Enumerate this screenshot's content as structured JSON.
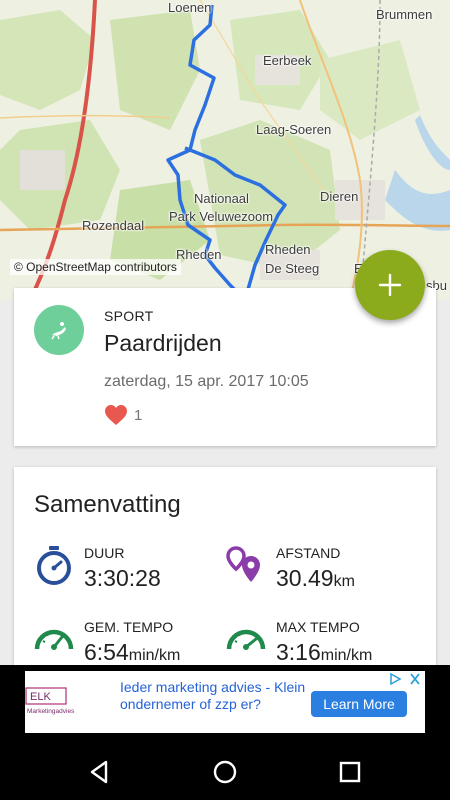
{
  "map": {
    "labels": {
      "loenen": "Loenen",
      "brummen": "Brummen",
      "eerbeek": "Eerbeek",
      "laag_soeren": "Laag-Soeren",
      "nationaal": "Nationaal",
      "park": "Park Veluwezoom",
      "dieren": "Dieren",
      "rozendaal": "Rozendaal",
      "rheden_top": "Rheden",
      "rheden": "Rheden",
      "de_steeg": "De Steeg",
      "e": "E",
      "sbu": "sbu"
    },
    "attribution": "© OpenStreetMap contributors",
    "route_color": "#2b6fe0"
  },
  "fab": {
    "icon": "plus-icon",
    "color": "#8cab1c"
  },
  "activity": {
    "kicker": "SPORT",
    "name": "Paardrijden",
    "date": "zaterdag, 15 apr. 2017 10:05",
    "likes": "1",
    "avatar_color": "#6fcf9b"
  },
  "summary": {
    "title": "Samenvatting",
    "stats": {
      "duration": {
        "label": "DUUR",
        "value": "3:30:28",
        "unit": ""
      },
      "distance": {
        "label": "AFSTAND",
        "value": "30.49",
        "unit": "km"
      },
      "avg_pace": {
        "label": "GEM. TEMPO",
        "value": "6:54",
        "unit": "min/km"
      },
      "max_pace": {
        "label": "MAX TEMPO",
        "value": "3:16",
        "unit": "min/km"
      }
    }
  },
  "ad": {
    "logo_text": "ELK",
    "logo_subtext": "Marketingadvies",
    "text": "Ieder marketing advies - Klein ondernemer of zzp er?",
    "button": "Learn More"
  },
  "colors": {
    "heart": "#e8584f",
    "duration_icon": "#2a4f9a",
    "distance_icon": "#8a3ca8",
    "pace_icon": "#1f8a4c"
  }
}
